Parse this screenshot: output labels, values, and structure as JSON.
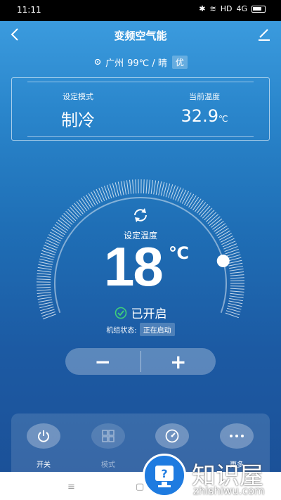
{
  "status_bar": {
    "time": "11:11",
    "network": "HD",
    "signal": "4G"
  },
  "header": {
    "title": "变频空气能"
  },
  "location": {
    "city": "广州",
    "weather": "99℃ / 晴",
    "aqi": "优"
  },
  "info": {
    "mode_label": "设定模式",
    "mode_value": "制冷",
    "current_temp_label": "当前温度",
    "current_temp_value": "32.9",
    "current_temp_unit": "℃"
  },
  "dial": {
    "set_label": "设定温度",
    "set_temp": "18",
    "set_unit": "℃",
    "power_state": "已开启",
    "unit_status_label": "机组状态:",
    "unit_status_value": "正在启动",
    "level_fraction": 0.84
  },
  "stepper": {
    "minus": "−",
    "plus": "+"
  },
  "controls": [
    {
      "label": "开关"
    },
    {
      "label": "模式"
    },
    {
      "label": ""
    },
    {
      "label": "更多"
    }
  ],
  "watermark": {
    "text": "知识屋",
    "sub": "zhishiwu.com"
  },
  "colors": {
    "accent": "#2a86cc",
    "check": "#3fd07a"
  }
}
